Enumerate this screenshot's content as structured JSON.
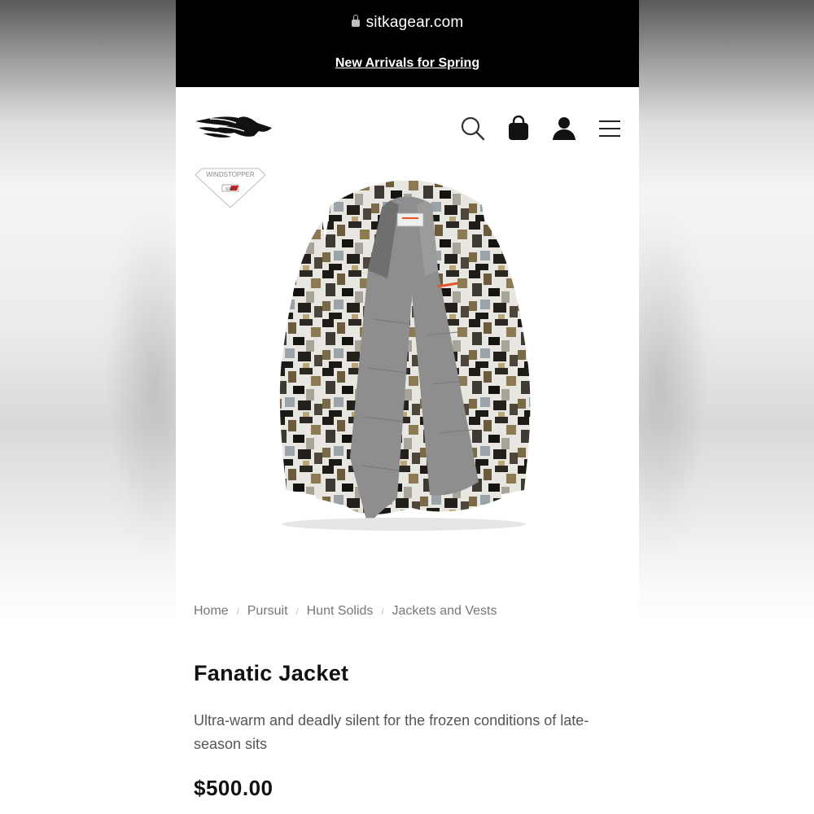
{
  "browser": {
    "url": "sitkagear.com"
  },
  "promo_banner": {
    "text": "New Arrivals for Spring"
  },
  "header": {
    "icons": [
      "search-icon",
      "shopping-bag-icon",
      "account-icon",
      "menu-icon"
    ]
  },
  "product": {
    "badge_text": "WINDSTOPPER",
    "badge_logo_text": "GORE",
    "breadcrumb": [
      "Home",
      "Pursuit",
      "Hunt Solids",
      "Jackets and Vests"
    ],
    "title": "Fanatic Jacket",
    "description": "Ultra-warm and deadly silent for the frozen conditions of late-season sits",
    "price": "$500.00"
  },
  "colors": {
    "top_bar": "#000000",
    "text_primary": "#111111",
    "text_muted": "#777777",
    "brand_accent": "#e8552b"
  }
}
